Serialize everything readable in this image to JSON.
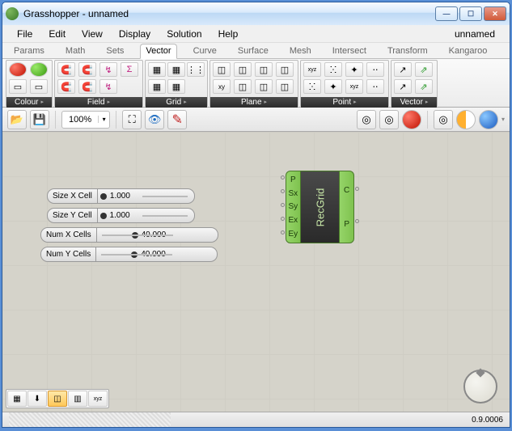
{
  "window": {
    "title": "Grasshopper - unnamed",
    "doc": "unnamed"
  },
  "menu": {
    "file": "File",
    "edit": "Edit",
    "view": "View",
    "display": "Display",
    "solution": "Solution",
    "help": "Help"
  },
  "tabs": {
    "params": "Params",
    "math": "Math",
    "sets": "Sets",
    "vector": "Vector",
    "curve": "Curve",
    "surface": "Surface",
    "mesh": "Mesh",
    "intersect": "Intersect",
    "transform": "Transform",
    "kangaroo": "Kangaroo"
  },
  "panels": {
    "colour": "Colour",
    "field": "Field",
    "grid": "Grid",
    "plane": "Plane",
    "point": "Point",
    "vector": "Vector"
  },
  "toolbar": {
    "zoom": "100%"
  },
  "sliders": [
    {
      "label": "Size X Cell",
      "value": "1.000"
    },
    {
      "label": "Size Y Cell",
      "value": "1.000"
    },
    {
      "label": "Num X Cells",
      "value": "40.000"
    },
    {
      "label": "Num Y Cells",
      "value": "40.000"
    }
  ],
  "component": {
    "name": "RecGrid",
    "inputs": [
      "P",
      "Sx",
      "Sy",
      "Ex",
      "Ey"
    ],
    "outputs": [
      "C",
      "P"
    ]
  },
  "status": {
    "version": "0.9.0006"
  },
  "icons": {
    "open": "📂",
    "save": "💾",
    "focus": "⛶",
    "eye": "👁",
    "pencil": "✎",
    "cyl1": "◎",
    "cyl2": "◎",
    "hex": "⬡",
    "magnet": "🧲",
    "spiral": "↯",
    "sum": "Σ",
    "grid1": "▦",
    "grid2": "▦",
    "grid3": "⋮⋮",
    "pl1": "◫",
    "pl2": "◫",
    "xy": "xy",
    "pt1": "ⵘ",
    "pt2": "✦",
    "pt3": "⋅⋅",
    "vec": "↗",
    "vec2": "⇗",
    "xyz": "xyz",
    "bt1": "▦",
    "bt2": "⬇",
    "bt3": "◫",
    "bt4": "▥",
    "bt5": "xyz"
  }
}
